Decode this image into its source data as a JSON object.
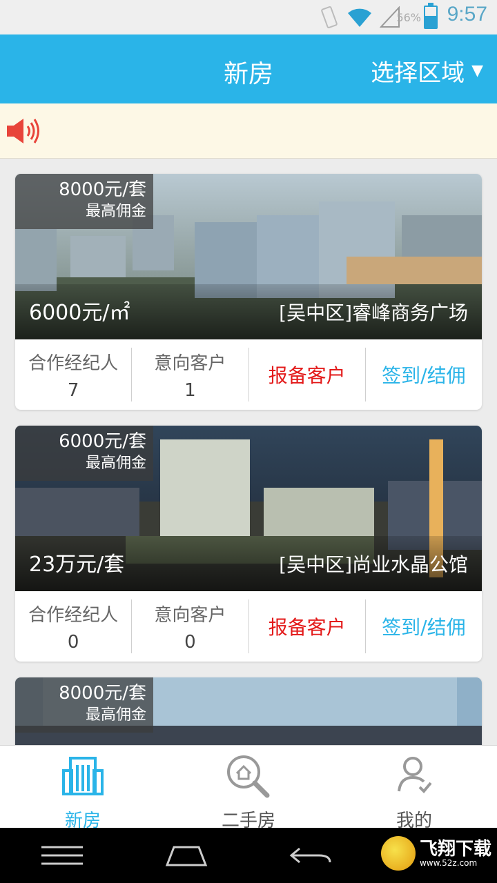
{
  "status_bar": {
    "time": "9:57",
    "battery_percent": "56%",
    "battery_level": 0.56
  },
  "header": {
    "title": "新房",
    "region_label": "选择区域",
    "region_caret": "▼"
  },
  "notice": {
    "icon": "speaker-icon",
    "text": ""
  },
  "listings": [
    {
      "commission_amount": "8000元/套",
      "commission_label": "最高佣金",
      "price": "6000元/㎡",
      "name": "[吴中区]睿峰商务广场",
      "agents_label": "合作经纪人",
      "agents_count": "7",
      "intent_label": "意向客户",
      "intent_count": "1",
      "register_label": "报备客户",
      "checkin_label": "签到/结佣"
    },
    {
      "commission_amount": "6000元/套",
      "commission_label": "最高佣金",
      "price": "23万元/套",
      "name": "[吴中区]尚业水晶公馆",
      "agents_label": "合作经纪人",
      "agents_count": "0",
      "intent_label": "意向客户",
      "intent_count": "0",
      "register_label": "报备客户",
      "checkin_label": "签到/结佣"
    },
    {
      "commission_amount": "8000元/套",
      "commission_label": "最高佣金"
    }
  ],
  "tabs": [
    {
      "label": "新房",
      "icon": "building-icon",
      "active": true
    },
    {
      "label": "二手房",
      "icon": "house-search-icon",
      "active": false
    },
    {
      "label": "我的",
      "icon": "user-icon",
      "active": false
    }
  ],
  "nav": {
    "menu": "menu-icon",
    "home": "home-icon",
    "back": "back-icon"
  },
  "watermark": {
    "text": "飞翔下载",
    "url": "www.52z.com"
  },
  "colors": {
    "accent": "#2ab4e8",
    "action_red": "#e31a1a",
    "notice_bg": "#fdf8e6"
  }
}
